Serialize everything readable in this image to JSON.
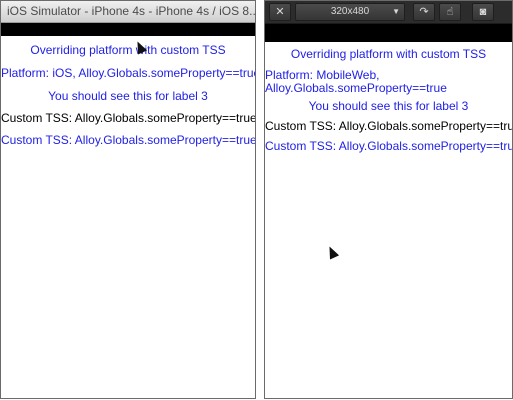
{
  "ios_simulator": {
    "title": "iOS Simulator - iPhone 4s - iPhone 4s / iOS 8....",
    "labels": [
      {
        "text": "Overriding platform with custom TSS",
        "color": "blue"
      },
      {
        "text": "Platform: iOS, Alloy.Globals.someProperty==true",
        "color": "blue"
      },
      {
        "text": "You should see this for label 3",
        "color": "blue"
      },
      {
        "text": "Custom TSS: Alloy.Globals.someProperty==true",
        "color": "black"
      },
      {
        "text": "Custom TSS: Alloy.Globals.someProperty==true",
        "color": "blue"
      }
    ]
  },
  "mobileweb": {
    "toolbar": {
      "close_icon": "close-icon",
      "resolution_value": "320x480",
      "rotate_icon": "rotate-icon",
      "touch_icon": "touch-icon",
      "camera_icon": "camera-icon"
    },
    "labels": [
      {
        "text": "Overriding platform with custom TSS",
        "color": "blue"
      },
      {
        "text": "Platform: MobileWeb,",
        "color": "blue"
      },
      {
        "text": "Alloy.Globals.someProperty==true",
        "color": "blue"
      },
      {
        "text": "You should see this for label 3",
        "color": "blue"
      },
      {
        "text": "Custom TSS: Alloy.Globals.someProperty==true",
        "color": "black"
      },
      {
        "text": "Custom TSS: Alloy.Globals.someProperty==true",
        "color": "blue"
      }
    ]
  },
  "colors": {
    "label_blue": "#2121e6",
    "label_black": "#000000"
  }
}
